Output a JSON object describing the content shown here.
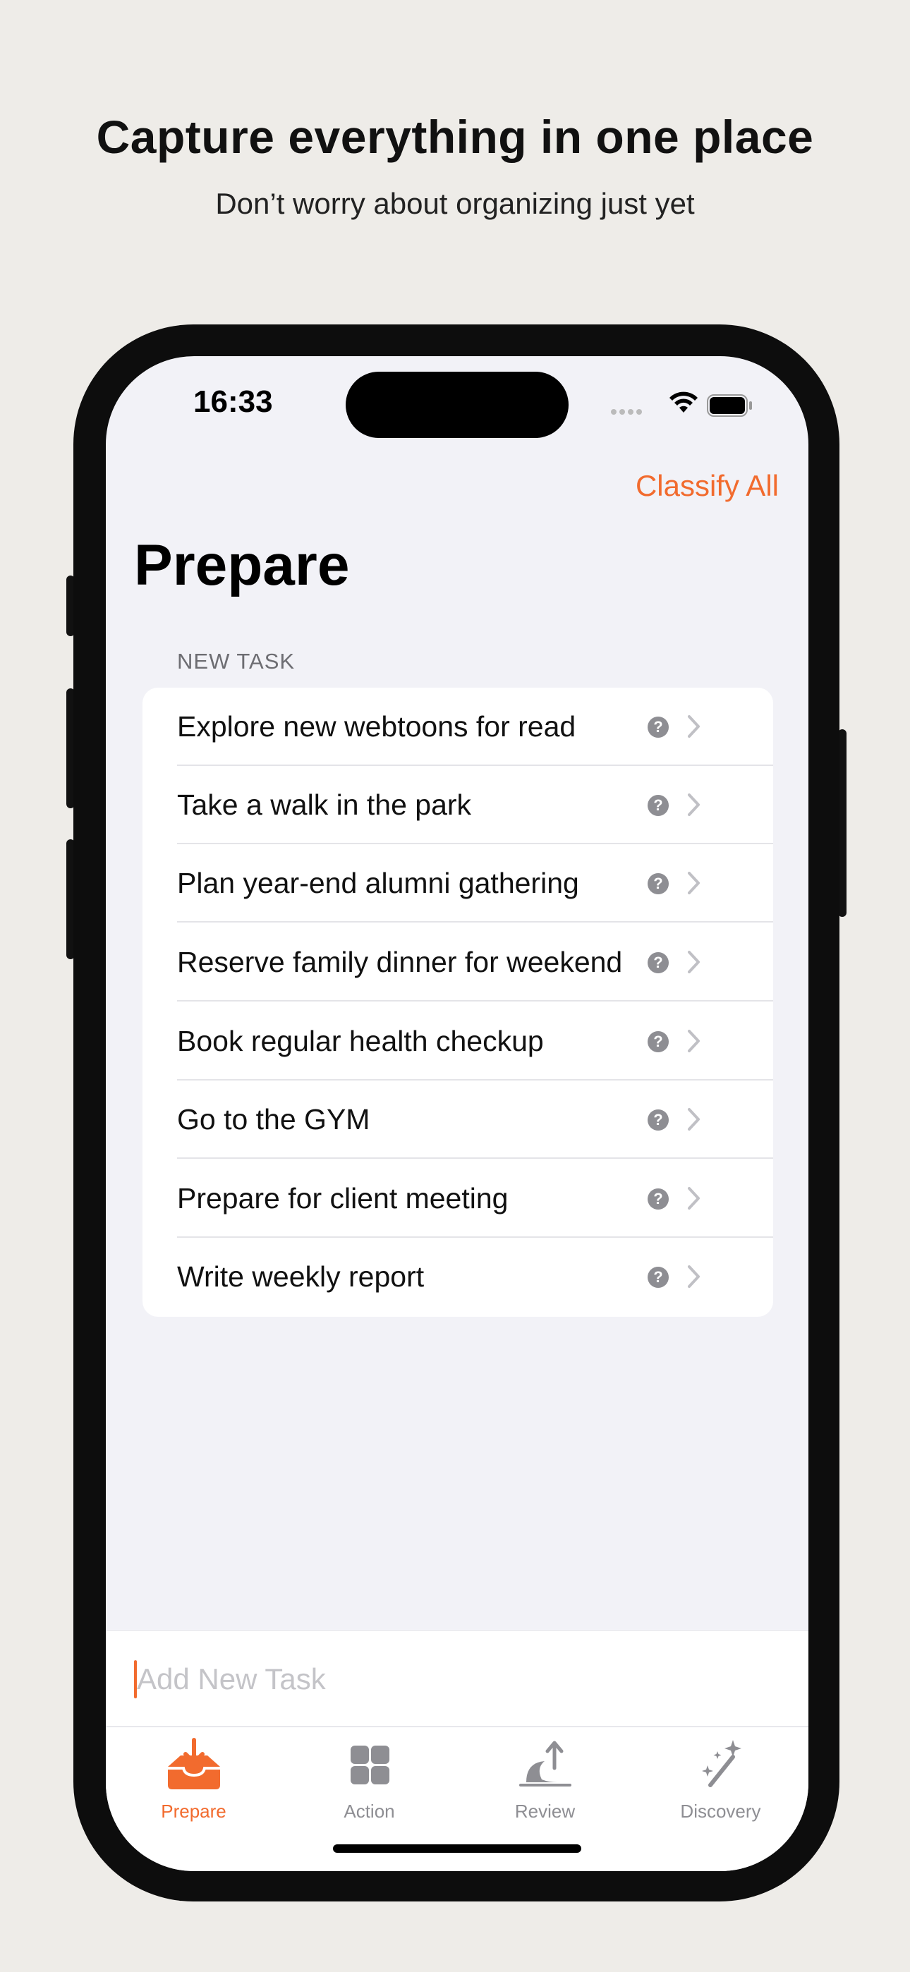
{
  "promo": {
    "headline": "Capture everything in one place",
    "subheadline": "Don’t worry about organizing just yet"
  },
  "status_bar": {
    "time": "16:33"
  },
  "header": {
    "action_label": "Classify All",
    "title": "Prepare"
  },
  "section": {
    "label": "NEW TASK"
  },
  "tasks": [
    {
      "label": "Explore new webtoons for read"
    },
    {
      "label": "Take a walk in the park"
    },
    {
      "label": "Plan year-end alumni gathering"
    },
    {
      "label": "Reserve family dinner for weekend"
    },
    {
      "label": "Book regular health checkup"
    },
    {
      "label": "Go to the GYM"
    },
    {
      "label": "Prepare for client meeting"
    },
    {
      "label": "Write weekly report"
    }
  ],
  "task_badge": "?",
  "input": {
    "placeholder": "Add New Task",
    "value": ""
  },
  "tabs": [
    {
      "label": "Prepare",
      "icon": "inbox-download-icon",
      "active": true
    },
    {
      "label": "Action",
      "icon": "grid-icon",
      "active": false
    },
    {
      "label": "Review",
      "icon": "sunrise-icon",
      "active": false
    },
    {
      "label": "Discovery",
      "icon": "magic-wand-icon",
      "active": false
    }
  ],
  "colors": {
    "accent": "#f26b2e",
    "background": "#eeece8",
    "screen": "#f2f2f7"
  }
}
